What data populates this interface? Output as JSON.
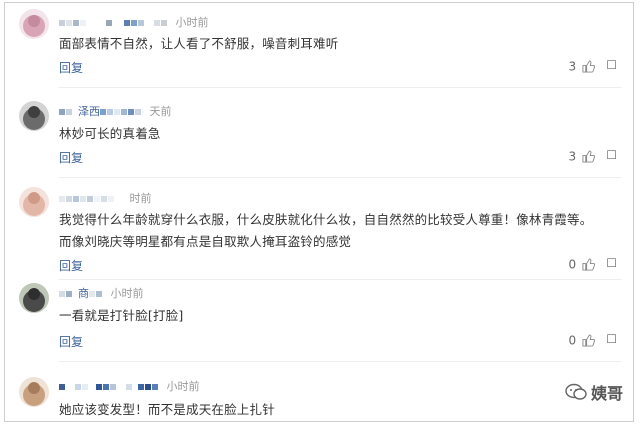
{
  "comments": [
    {
      "time": "小时前",
      "text": "面部表情不自然，让人看了不舒服，噪音刺耳难听",
      "reply_label": "回复",
      "likes": "3",
      "avatar_color": "#d9a5b6"
    },
    {
      "username_visible": "泽西",
      "time": "天前",
      "text": "林妙可长的真着急",
      "reply_label": "回复",
      "likes": "3",
      "avatar_color": "#6b6b6b"
    },
    {
      "time": "时前",
      "text": "我觉得什么年龄就穿什么衣服，什么皮肤就化什么妆，自自然然的比较受人尊重！像林青霞等。而像刘晓庆等明星都有点是自取欺人掩耳盗铃的感觉",
      "reply_label": "回复",
      "likes": "0",
      "avatar_color": "#e3b7a8"
    },
    {
      "username_visible": "商",
      "time": "小时前",
      "text": "一看就是打针脸[打脸]",
      "reply_label": "回复",
      "likes": "0",
      "avatar_color": "#4a4a4a"
    },
    {
      "time": "小时前",
      "text": "她应该变发型！而不是成天在脸上扎针",
      "avatar_color": "#c9a07e"
    }
  ],
  "more_glyph": "☐",
  "watermark": {
    "text": "姨哥"
  }
}
